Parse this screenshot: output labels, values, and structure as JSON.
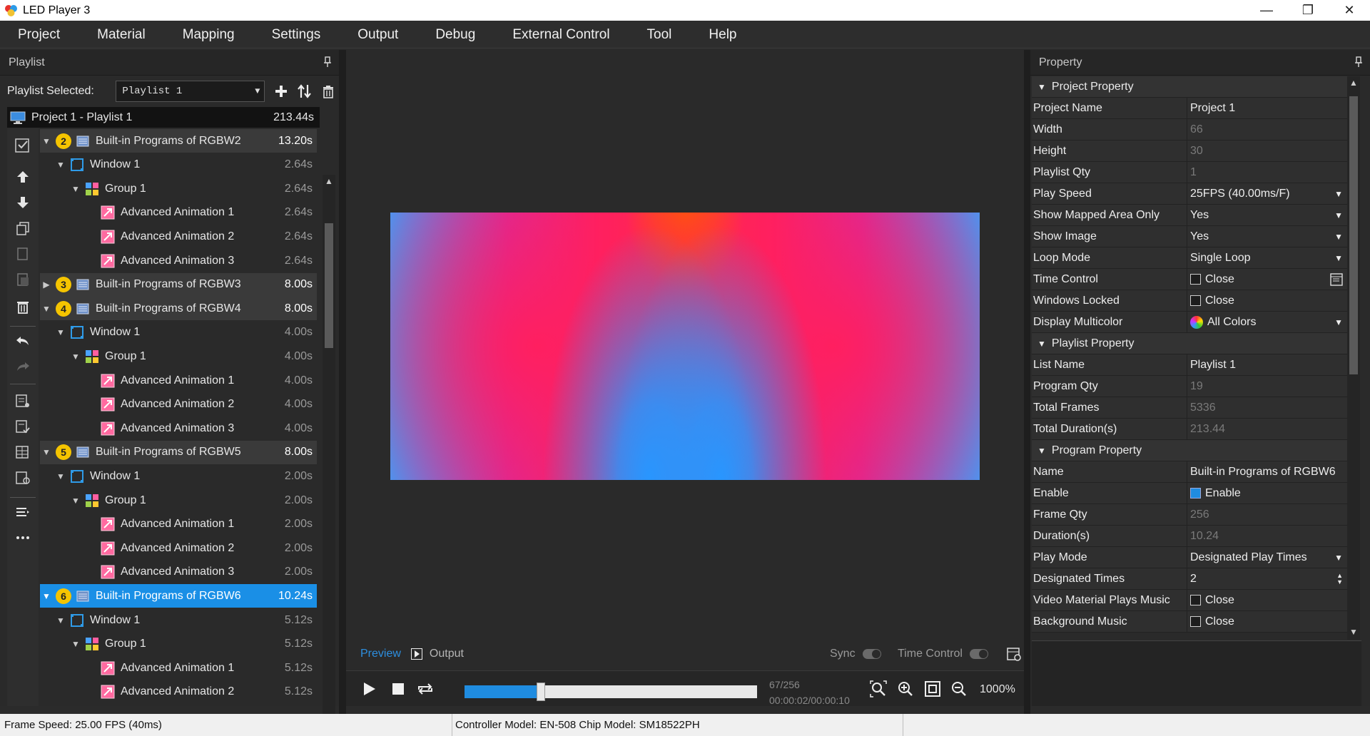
{
  "window": {
    "title": "LED Player 3",
    "minimize": "—",
    "maximize": "❐",
    "close": "✕"
  },
  "menu": [
    "Project",
    "Material",
    "Mapping",
    "Settings",
    "Output",
    "Debug",
    "External Control",
    "Tool",
    "Help"
  ],
  "playlist_panel": {
    "title": "Playlist",
    "selected_label": "Playlist Selected:",
    "selected_value": "Playlist 1",
    "root": {
      "label": "Project 1 - Playlist 1",
      "duration": "213.44s"
    },
    "items": [
      {
        "level": "program",
        "num": "2",
        "label": "Built-in Programs of RGBW2",
        "duration": "13.20s",
        "expanded": true
      },
      {
        "level": "window",
        "label": "Window 1",
        "duration": "2.64s"
      },
      {
        "level": "group",
        "label": "Group 1",
        "duration": "2.64s"
      },
      {
        "level": "anim",
        "label": "Advanced Animation 1",
        "duration": "2.64s"
      },
      {
        "level": "anim",
        "label": "Advanced Animation 2",
        "duration": "2.64s"
      },
      {
        "level": "anim",
        "label": "Advanced Animation 3",
        "duration": "2.64s"
      },
      {
        "level": "program",
        "num": "3",
        "label": "Built-in Programs of RGBW3",
        "duration": "8.00s",
        "expanded": false
      },
      {
        "level": "program",
        "num": "4",
        "label": "Built-in Programs of RGBW4",
        "duration": "8.00s",
        "expanded": true
      },
      {
        "level": "window",
        "label": "Window 1",
        "duration": "4.00s"
      },
      {
        "level": "group",
        "label": "Group 1",
        "duration": "4.00s"
      },
      {
        "level": "anim",
        "label": "Advanced Animation 1",
        "duration": "4.00s"
      },
      {
        "level": "anim",
        "label": "Advanced Animation 2",
        "duration": "4.00s"
      },
      {
        "level": "anim",
        "label": "Advanced Animation 3",
        "duration": "4.00s"
      },
      {
        "level": "program",
        "num": "5",
        "label": "Built-in Programs of RGBW5",
        "duration": "8.00s",
        "expanded": true
      },
      {
        "level": "window",
        "label": "Window 1",
        "duration": "2.00s"
      },
      {
        "level": "group",
        "label": "Group 1",
        "duration": "2.00s"
      },
      {
        "level": "anim",
        "label": "Advanced Animation 1",
        "duration": "2.00s"
      },
      {
        "level": "anim",
        "label": "Advanced Animation 2",
        "duration": "2.00s"
      },
      {
        "level": "anim",
        "label": "Advanced Animation 3",
        "duration": "2.00s"
      },
      {
        "level": "program",
        "num": "6",
        "label": "Built-in Programs of RGBW6",
        "duration": "10.24s",
        "expanded": true,
        "selected": true
      },
      {
        "level": "window",
        "label": "Window 1",
        "duration": "5.12s"
      },
      {
        "level": "group",
        "label": "Group 1",
        "duration": "5.12s"
      },
      {
        "level": "anim",
        "label": "Advanced Animation 1",
        "duration": "5.12s"
      },
      {
        "level": "anim",
        "label": "Advanced Animation 2",
        "duration": "5.12s"
      }
    ]
  },
  "preview": {
    "tab_preview": "Preview",
    "tab_output": "Output",
    "sync_label": "Sync",
    "time_control_label": "Time Control",
    "frame_counter": "67/256",
    "time_counter": "00:00:02/00:00:10",
    "progress_fraction": 0.26,
    "zoom": "1000%"
  },
  "property_panel": {
    "title": "Property",
    "sections": [
      {
        "title": "Project Property",
        "rows": [
          {
            "key": "Project Name",
            "value": "Project 1"
          },
          {
            "key": "Width",
            "value": "66",
            "readonly": true
          },
          {
            "key": "Height",
            "value": "30",
            "readonly": true
          },
          {
            "key": "Playlist Qty",
            "value": "1",
            "readonly": true
          },
          {
            "key": "Play Speed",
            "value": "25FPS (40.00ms/F)",
            "dropdown": true
          },
          {
            "key": "Show Mapped Area Only",
            "value": "Yes",
            "dropdown": true
          },
          {
            "key": "Show Image",
            "value": "Yes",
            "dropdown": true
          },
          {
            "key": "Loop Mode",
            "value": "Single Loop",
            "dropdown": true
          },
          {
            "key": "Time Control",
            "value": "Close",
            "checkbox": false,
            "extra_button": true
          },
          {
            "key": "Windows Locked",
            "value": "Close",
            "checkbox": false
          },
          {
            "key": "Display Multicolor",
            "value": "All Colors",
            "dropdown": true,
            "color_icon": true
          }
        ]
      },
      {
        "title": "Playlist Property",
        "rows": [
          {
            "key": "List Name",
            "value": "Playlist 1"
          },
          {
            "key": "Program Qty",
            "value": "19",
            "readonly": true
          },
          {
            "key": "Total Frames",
            "value": "5336",
            "readonly": true
          },
          {
            "key": "Total Duration(s)",
            "value": "213.44",
            "readonly": true
          }
        ]
      },
      {
        "title": "Program Property",
        "rows": [
          {
            "key": "Name",
            "value": "Built-in Programs of RGBW6"
          },
          {
            "key": "Enable",
            "value": "Enable",
            "checkbox": true
          },
          {
            "key": "Frame Qty",
            "value": "256",
            "readonly": true
          },
          {
            "key": "Duration(s)",
            "value": "10.24",
            "readonly": true
          },
          {
            "key": "Play Mode",
            "value": "Designated Play Times",
            "dropdown": true
          },
          {
            "key": "Designated Times",
            "value": "2",
            "spinner": true
          },
          {
            "key": "Video Material Plays Music",
            "value": "Close",
            "checkbox": false
          },
          {
            "key": "Background Music",
            "value": "Close",
            "checkbox": false
          }
        ]
      }
    ]
  },
  "status": {
    "frame_speed": "Frame Speed:  25.00 FPS (40ms)",
    "controller": "Controller Model: EN-508  Chip Model: SM18522PH"
  },
  "colors": {
    "accent": "#1f8ce0",
    "selection": "#1a8fe6",
    "badge": "#f5c400",
    "background": "#2b2b2b"
  }
}
